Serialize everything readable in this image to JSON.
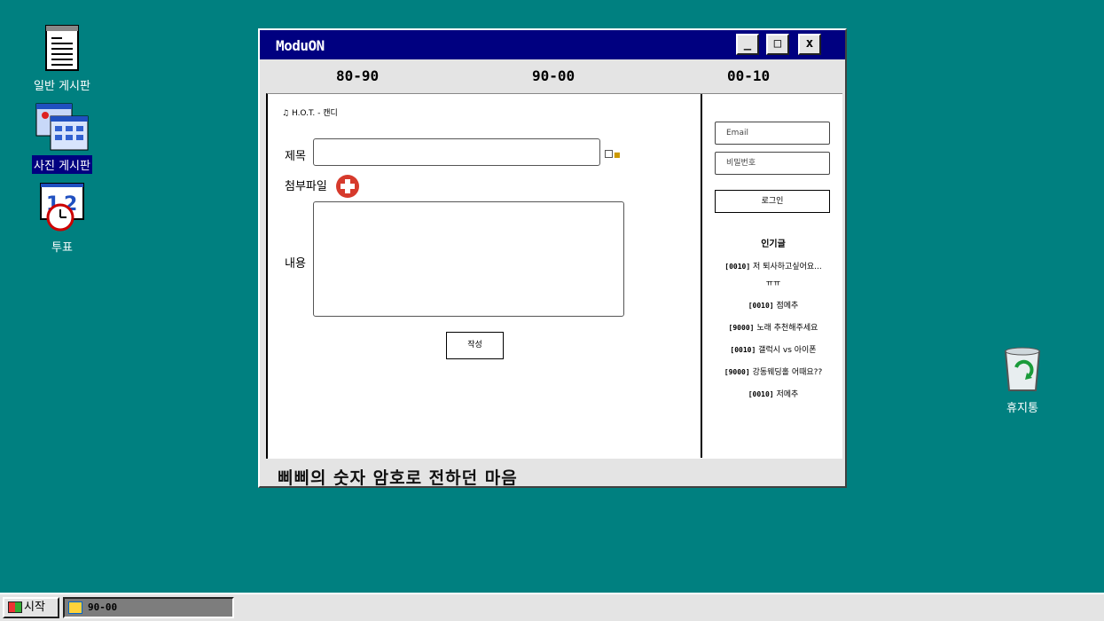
{
  "desktop": {
    "icons": [
      {
        "label": "일반 게시판"
      },
      {
        "label": "사진 게시판"
      },
      {
        "label": "투표"
      },
      {
        "label": "휴지통"
      }
    ]
  },
  "window": {
    "title": "ModuON",
    "controls": {
      "minimize": "_",
      "maximize": "□",
      "close": "x"
    },
    "tabs": [
      "80-90",
      "90-00",
      "00-10"
    ],
    "breadcrumb": "H.O.T. - 캔디",
    "form": {
      "title_label": "제목",
      "attachment_label": "첨부파일",
      "content_label": "내용",
      "submit_label": "작성"
    },
    "sidebar": {
      "email_placeholder": "Email",
      "password_placeholder": "비밀번호",
      "login_label": "로그인",
      "popular_title": "인기글",
      "popular_posts": [
        {
          "tag": "[0010]",
          "text": "저 퇴사하고싶어요..."
        },
        {
          "tag": "",
          "text": "ㅠㅠ"
        },
        {
          "tag": "[0010]",
          "text": "점메추"
        },
        {
          "tag": "[9000]",
          "text": "노래 추천해주세요"
        },
        {
          "tag": "[0010]",
          "text": "갤럭시 vs 아이폰"
        },
        {
          "tag": "[9000]",
          "text": "강동웨딩홀 어때요??"
        },
        {
          "tag": "[0010]",
          "text": "저메추"
        }
      ]
    },
    "marquee": "삐삐의 숫자 암호로 전하던 마음"
  },
  "taskbar": {
    "start_label": "시작",
    "task_label": "90-00"
  }
}
